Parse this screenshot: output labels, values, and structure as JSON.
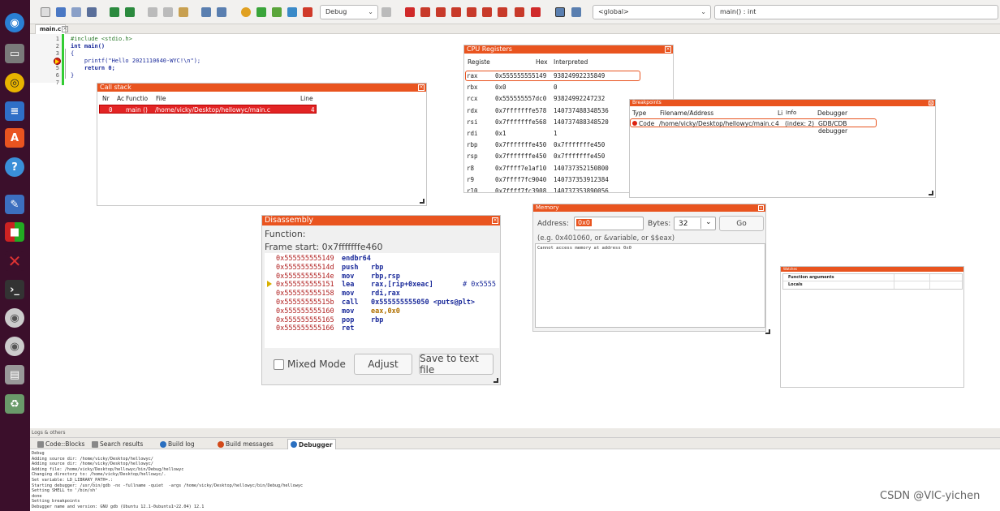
{
  "toolbar": {
    "build_target": "Debug",
    "scope": "<global>",
    "function": "main() : int"
  },
  "editor": {
    "tab": "main.c",
    "line_numbers": [
      "1",
      "2",
      "3",
      "4",
      "5",
      "6",
      "7"
    ],
    "lines": [
      "#include <stdio.h>",
      "int main()",
      "{",
      "    printf(\"Hello 2021110640-WYC!\\n\");",
      "    return 0;",
      "}",
      ""
    ]
  },
  "call_stack": {
    "title": "Call stack",
    "headers": [
      "Nr",
      "Ac",
      "Functio",
      "File",
      "Line"
    ],
    "row": {
      "nr": "0",
      "ac": "",
      "function": "main ()",
      "file": "/home/vicky/Desktop/hellowyc/main.c",
      "line": "4"
    }
  },
  "cpu_registers": {
    "title": "CPU Registers",
    "headers": [
      "Registe",
      "Hex",
      "Interpreted"
    ],
    "rows": [
      {
        "reg": "rax",
        "hex": "0x555555555149",
        "interp": "93824992235849"
      },
      {
        "reg": "rbx",
        "hex": "0x0",
        "interp": "0"
      },
      {
        "reg": "rcx",
        "hex": "0x555555557dc0",
        "interp": "93824992247232"
      },
      {
        "reg": "rdx",
        "hex": "0x7fffffffe578",
        "interp": "140737488348536"
      },
      {
        "reg": "rsi",
        "hex": "0x7fffffffe568",
        "interp": "140737488348520"
      },
      {
        "reg": "rdi",
        "hex": "0x1",
        "interp": "1"
      },
      {
        "reg": "rbp",
        "hex": "0x7fffffffe450",
        "interp": "0x7fffffffe450"
      },
      {
        "reg": "rsp",
        "hex": "0x7fffffffe450",
        "interp": "0x7fffffffe450"
      },
      {
        "reg": "r8",
        "hex": "0x7ffff7e1af10",
        "interp": "140737352150800"
      },
      {
        "reg": "r9",
        "hex": "0x7ffff7fc9040",
        "interp": "140737353912384"
      },
      {
        "reg": "r10",
        "hex": "0x7ffff7fc3908",
        "interp": "140737353890056"
      }
    ]
  },
  "breakpoints": {
    "title": "Breakpoints",
    "headers": [
      "Type",
      "Filename/Address",
      "Li",
      "Info",
      "Debugger"
    ],
    "row": {
      "type": "Code",
      "file": "/home/vicky/Desktop/hellowyc/main.c",
      "line": "4",
      "info": "(index: 2)",
      "debugger": "GDB/CDB debugger"
    }
  },
  "disassembly": {
    "title": "Disassembly",
    "function_label": "Function:",
    "frame_start": "Frame start: 0x7fffffffe460",
    "rows": [
      {
        "addr": "0x555555555149",
        "op": "endbr64",
        "args": ""
      },
      {
        "addr": "0x55555555514d",
        "op": "push",
        "args": "rbp"
      },
      {
        "addr": "0x55555555514e",
        "op": "mov",
        "args": "rbp,rsp"
      },
      {
        "addr": "0x555555555151",
        "op": "lea",
        "args": "rax,[rip+0xeac]",
        "comment": "# 0x5555"
      },
      {
        "addr": "0x555555555158",
        "op": "mov",
        "args": "rdi,rax"
      },
      {
        "addr": "0x55555555515b",
        "op": "call",
        "args": "0x555555555050 <puts@plt>"
      },
      {
        "addr": "0x555555555160",
        "op": "mov",
        "args": "eax,0x0"
      },
      {
        "addr": "0x555555555165",
        "op": "pop",
        "args": "rbp"
      },
      {
        "addr": "0x555555555166",
        "op": "ret",
        "args": ""
      }
    ],
    "mixed_mode": "Mixed Mode",
    "adjust": "Adjust",
    "save": "Save to text file"
  },
  "memory": {
    "title": "Memory",
    "address_label": "Address:",
    "address_value": "0x0",
    "bytes_label": "Bytes:",
    "bytes_value": "32",
    "go": "Go",
    "hint": "(e.g. 0x401060, or &variable, or $$eax)",
    "output": "Cannot access memory at address 0x0"
  },
  "watches": {
    "title": "Watches",
    "rows": [
      "Function arguments",
      "Locals"
    ]
  },
  "logs": {
    "title": "Logs & others",
    "tabs": [
      "Code::Blocks",
      "Search results",
      "Build log",
      "Build messages",
      "Debugger"
    ],
    "lines": [
      "Debug",
      "Adding source dir: /home/vicky/Desktop/hellowyc/",
      "Adding source dir: /home/vicky/Desktop/hellowyc/",
      "Adding file: /home/vicky/Desktop/hellowyc/bin/Debug/hellowyc",
      "Changing directory to: /home/vicky/Desktop/hellowyc/.",
      "Set variable: LD_LIBRARY_PATH=.:",
      "Starting debugger: /usr/bin/gdb -nx -fullname -quiet  -args /home/vicky/Desktop/hellowyc/bin/Debug/hellowyc",
      "Setting SHELL to '/bin/sh'",
      "done",
      "Setting breakpoints",
      "Debugger name and version: GNU gdb (Ubuntu 12.1-0ubuntu1~22.04) 12.1"
    ]
  },
  "watermark": "CSDN @VIC-yichen"
}
